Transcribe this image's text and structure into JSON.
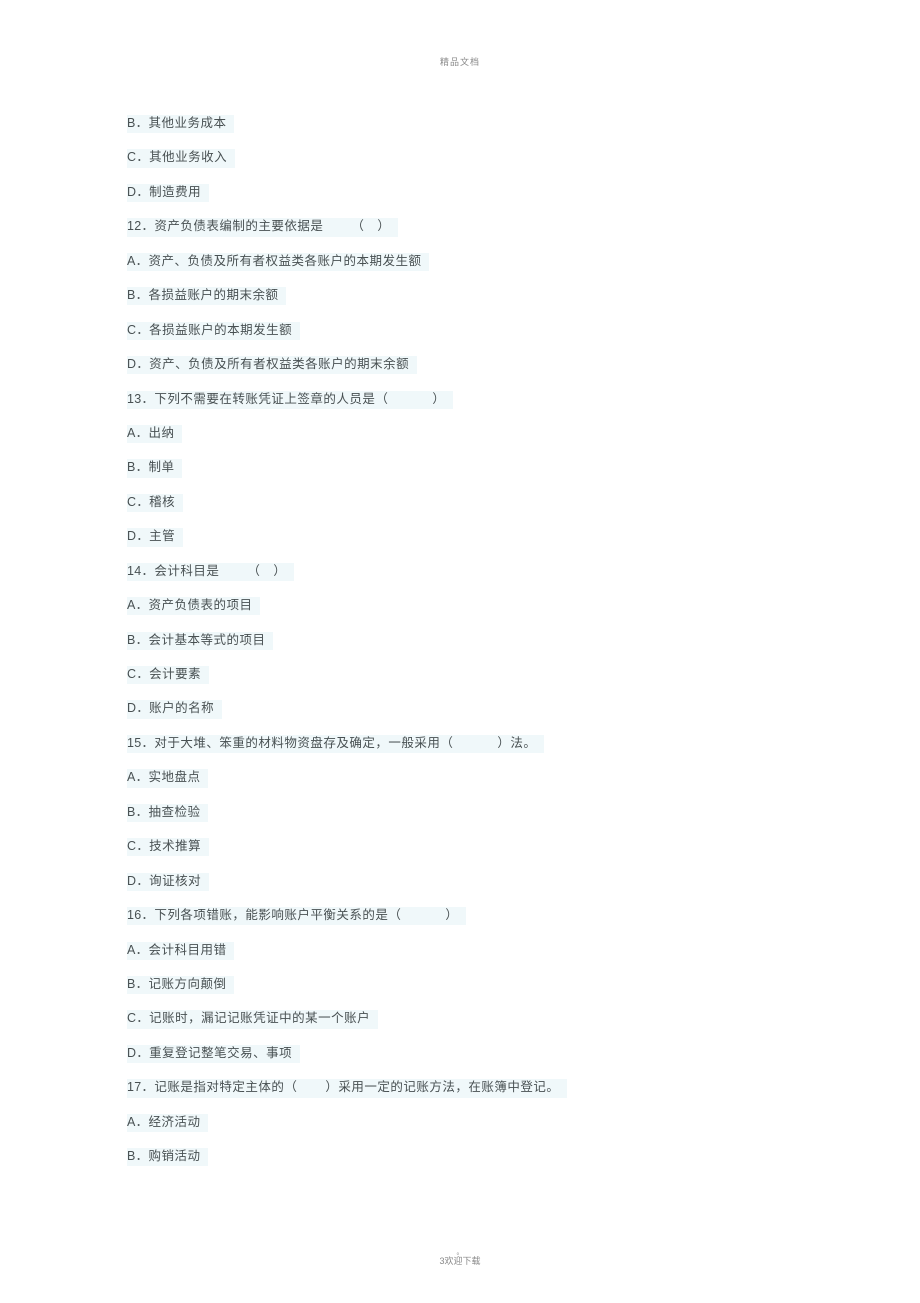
{
  "header": {
    "label": "精品文档"
  },
  "lines": [
    {
      "prefix": "B．",
      "text": "其他业务成本"
    },
    {
      "prefix": "C．",
      "text": "其他业务收入"
    },
    {
      "prefix": "D．",
      "text": "制造费用"
    },
    {
      "prefix": "12．",
      "text": "资产负债表编制的主要依据是",
      "blank_type": "spacer",
      "suffix": "（　）"
    },
    {
      "prefix": "A．",
      "text": "资产、负债及所有者权益类各账户的本期发生额"
    },
    {
      "prefix": "B．",
      "text": "各损益账户的期末余额"
    },
    {
      "prefix": "C．",
      "text": "各损益账户的本期发生额"
    },
    {
      "prefix": "D．",
      "text": "资产、负债及所有者权益类各账户的期末余额"
    },
    {
      "prefix": "13．",
      "text": "下列不需要在转账凭证上签章的人员是（",
      "blank_type": "spacer-lg",
      "suffix": "）"
    },
    {
      "prefix": "A．",
      "text": "出纳"
    },
    {
      "prefix": "B．",
      "text": "制单"
    },
    {
      "prefix": "C．",
      "text": "稽核"
    },
    {
      "prefix": "D．",
      "text": "主管"
    },
    {
      "prefix": "14．",
      "text": "会计科目是",
      "blank_type": "spacer",
      "suffix": "（　）"
    },
    {
      "prefix": "A．",
      "text": "资产负债表的项目"
    },
    {
      "prefix": "B．",
      "text": "会计基本等式的项目"
    },
    {
      "prefix": "C．",
      "text": "会计要素"
    },
    {
      "prefix": "D．",
      "text": "账户的名称"
    },
    {
      "prefix": "15．",
      "text": "对于大堆、笨重的材料物资盘存及确定，一般采用（",
      "blank_type": "spacer-lg",
      "suffix": "）法。"
    },
    {
      "prefix": "A．",
      "text": "实地盘点"
    },
    {
      "prefix": "B．",
      "text": "抽查检验"
    },
    {
      "prefix": "C．",
      "text": "技术推算"
    },
    {
      "prefix": "D．",
      "text": "询证核对"
    },
    {
      "prefix": "16．",
      "text": "下列各项错账，能影响账户平衡关系的是（",
      "blank_type": "spacer-lg",
      "suffix": "）"
    },
    {
      "prefix": "A．",
      "text": "会计科目用错"
    },
    {
      "prefix": "B．",
      "text": "记账方向颠倒"
    },
    {
      "prefix": "C．",
      "text": "记账时，漏记记账凭证中的某一个账户"
    },
    {
      "prefix": "D．",
      "text": "重复登记整笔交易、事项"
    },
    {
      "prefix": "17．",
      "text": "记账是指对特定主体的（",
      "blank_type": "spacer",
      "suffix": "）采用一定的记账方法，在账簿中登记。"
    },
    {
      "prefix": "A．",
      "text": "经济活动"
    },
    {
      "prefix": "B．",
      "text": "购销活动"
    }
  ],
  "footer": {
    "page_number": "3",
    "text": "欢迎下载"
  }
}
